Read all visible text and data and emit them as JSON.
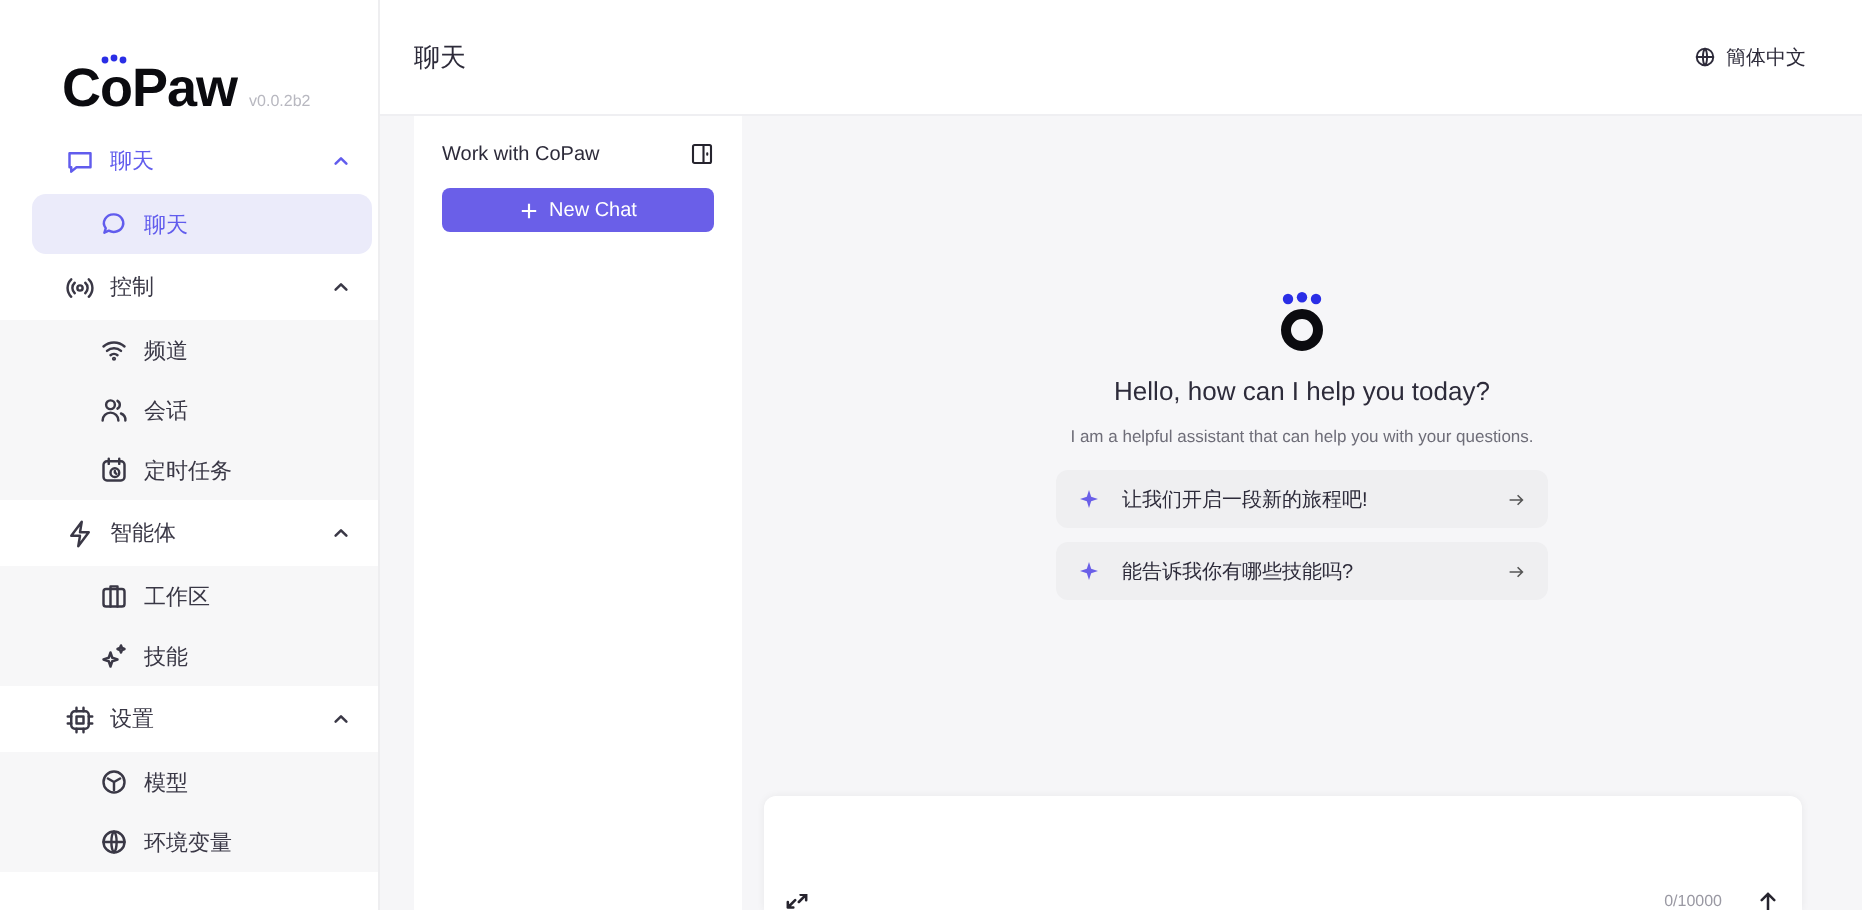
{
  "brand": {
    "logo": "CoPaw",
    "version": "v0.0.2b2"
  },
  "sidebar": {
    "groups": [
      {
        "label": "聊天",
        "expanded": true,
        "children": [
          {
            "label": "聊天",
            "selected": true
          }
        ]
      },
      {
        "label": "控制",
        "expanded": true,
        "children": [
          {
            "label": "频道",
            "selected": false
          },
          {
            "label": "会话",
            "selected": false
          },
          {
            "label": "定时任务",
            "selected": false
          }
        ]
      },
      {
        "label": "智能体",
        "expanded": true,
        "children": [
          {
            "label": "工作区",
            "selected": false
          },
          {
            "label": "技能",
            "selected": false
          }
        ]
      },
      {
        "label": "设置",
        "expanded": true,
        "children": [
          {
            "label": "模型",
            "selected": false
          },
          {
            "label": "环境变量",
            "selected": false
          }
        ]
      }
    ]
  },
  "header": {
    "title": "聊天",
    "language": "簡体中文"
  },
  "chat_list": {
    "title": "Work with CoPaw",
    "new_chat": "New Chat"
  },
  "welcome": {
    "title": "Hello, how can I help you today?",
    "subtitle": "I am a helpful assistant that can help you with your questions.",
    "suggestions": [
      "让我们开启一段新的旅程吧!",
      "能告诉我你有哪些技能吗?"
    ]
  },
  "composer": {
    "counter": "0/10000"
  }
}
